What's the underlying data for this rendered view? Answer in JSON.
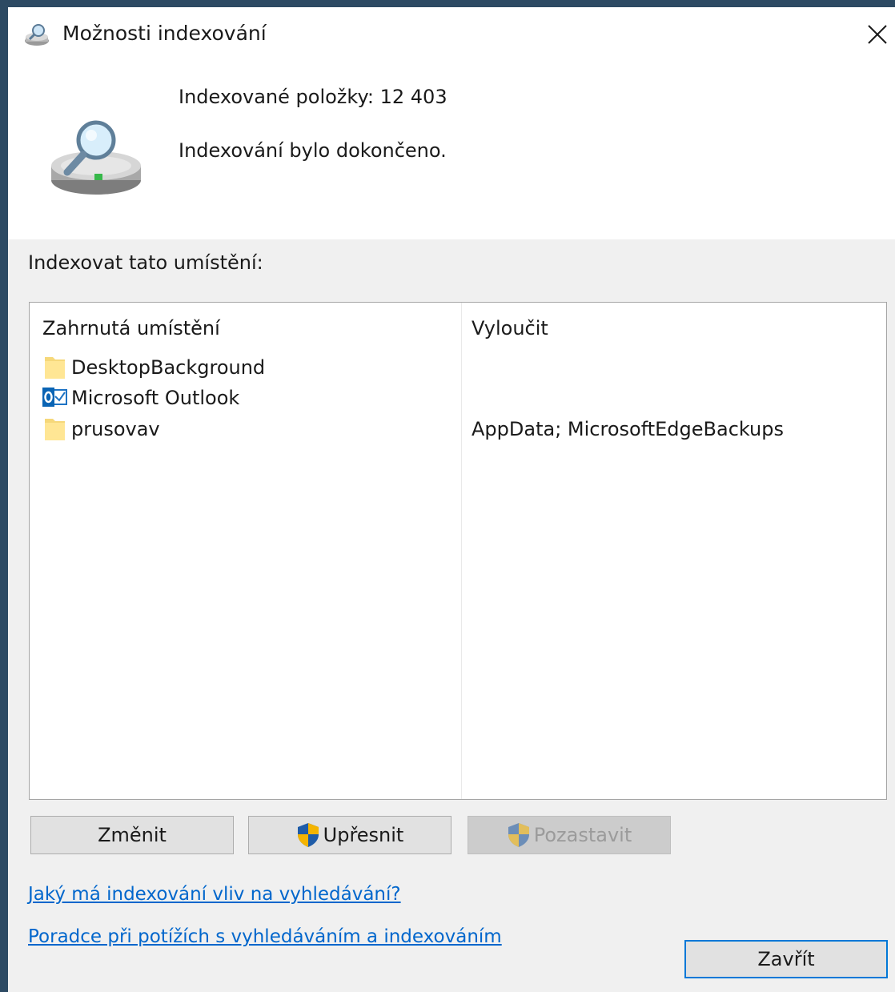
{
  "window": {
    "title": "Možnosti indexování",
    "close_glyph": "✕"
  },
  "header": {
    "indexed_items": "Indexované položky: 12 403",
    "status": "Indexování bylo dokončeno."
  },
  "section": {
    "label": "Indexovat tato umístění:"
  },
  "locations": {
    "columns": {
      "included": "Zahrnutá umístění",
      "excluded": "Vyloučit"
    },
    "rows": [
      {
        "icon": "folder-icon",
        "name": "DesktopBackground",
        "exclude": ""
      },
      {
        "icon": "outlook-icon",
        "name": "Microsoft Outlook",
        "exclude": ""
      },
      {
        "icon": "folder-icon",
        "name": "prusovav",
        "exclude": "AppData; MicrosoftEdgeBackups"
      }
    ]
  },
  "buttons": {
    "modify": "Změnit",
    "advanced": "Upřesnit",
    "pause": "Pozastavit",
    "close": "Zavřít"
  },
  "links": {
    "how_affects": "Jaký má indexování vliv na vyhledávání?",
    "troubleshoot": "Poradce při potížích s vyhledáváním a indexováním"
  },
  "colors": {
    "link": "#0066cc",
    "accent_border": "#0078d7",
    "desktop_bg": "#2d4a63"
  }
}
